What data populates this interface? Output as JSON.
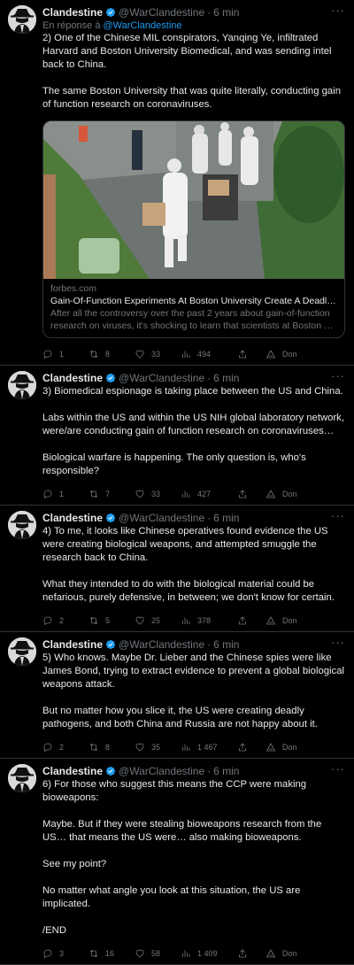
{
  "colors": {
    "background": "#000000",
    "text": "#e7e9ea",
    "muted": "#71767b",
    "link": "#1d9bf0",
    "border": "#2f3336",
    "verified": "#1d9bf0"
  },
  "more_label": "···",
  "actions_icons": [
    "reply-icon",
    "retweet-icon",
    "like-icon",
    "views-icon",
    "share-icon",
    "donate-icon"
  ],
  "tweets": [
    {
      "user": "Clandestine",
      "handle": "@WarClandestine",
      "sep": "·",
      "time": "6 min",
      "reply_prefix": "En réponse à",
      "reply_to": "@WarClandestine",
      "paragraphs": [
        "2) One of the Chinese MIL conspirators, Yanqing Ye, infiltrated Harvard and Boston University Biomedical, and was sending intel back to China.",
        "The same Boston University that was quite literally, conducting gain of function research on coronaviruses."
      ],
      "card": {
        "domain": "forbes.com",
        "title": "Gain-Of-Function Experiments At Boston University Create A Deadl…",
        "description": "After all the controversy over the past 2 years about gain-of-function research on viruses, it's shocking to learn that scientists at Boston …"
      },
      "replies": "1",
      "retweets": "8",
      "likes": "33",
      "views": "494",
      "donate": "Don"
    },
    {
      "user": "Clandestine",
      "handle": "@WarClandestine",
      "sep": "·",
      "time": "6 min",
      "paragraphs": [
        "3) Biomedical espionage is taking place between the US and China.",
        "Labs within the US and within the US NIH global laboratory network, were/are conducting gain of function research on coronaviruses…",
        "Biological warfare is happening. The only question is, who's responsible?"
      ],
      "replies": "1",
      "retweets": "7",
      "likes": "33",
      "views": "427",
      "donate": "Don"
    },
    {
      "user": "Clandestine",
      "handle": "@WarClandestine",
      "sep": "·",
      "time": "6 min",
      "paragraphs": [
        "4) To me, it looks like Chinese operatives found evidence the US were creating biological weapons, and attempted smuggle the research back to China.",
        "What they intended to do with the biological material could be nefarious, purely defensive, in between; we don't know for certain."
      ],
      "replies": "2",
      "retweets": "5",
      "likes": "25",
      "views": "378",
      "donate": "Don"
    },
    {
      "user": "Clandestine",
      "handle": "@WarClandestine",
      "sep": "·",
      "time": "6 min",
      "paragraphs": [
        "5) Who knows. Maybe Dr. Lieber and the Chinese spies were like James Bond, trying to extract evidence to prevent a global biological weapons attack.",
        "But no matter how you slice it, the US were creating deadly pathogens, and both China and Russia are not happy about it."
      ],
      "replies": "2",
      "retweets": "8",
      "likes": "35",
      "views": "1 467",
      "donate": "Don"
    },
    {
      "user": "Clandestine",
      "handle": "@WarClandestine",
      "sep": "·",
      "time": "6 min",
      "paragraphs": [
        "6) For those who suggest this means the CCP were making bioweapons:",
        "Maybe. But if they were stealing bioweapons research from the US… that means the US were… also making bioweapons.",
        "See my point?",
        "No matter what angle you look at this situation, the US are implicated.",
        "/END"
      ],
      "replies": "3",
      "retweets": "16",
      "likes": "58",
      "views": "1 409",
      "donate": "Don"
    }
  ]
}
